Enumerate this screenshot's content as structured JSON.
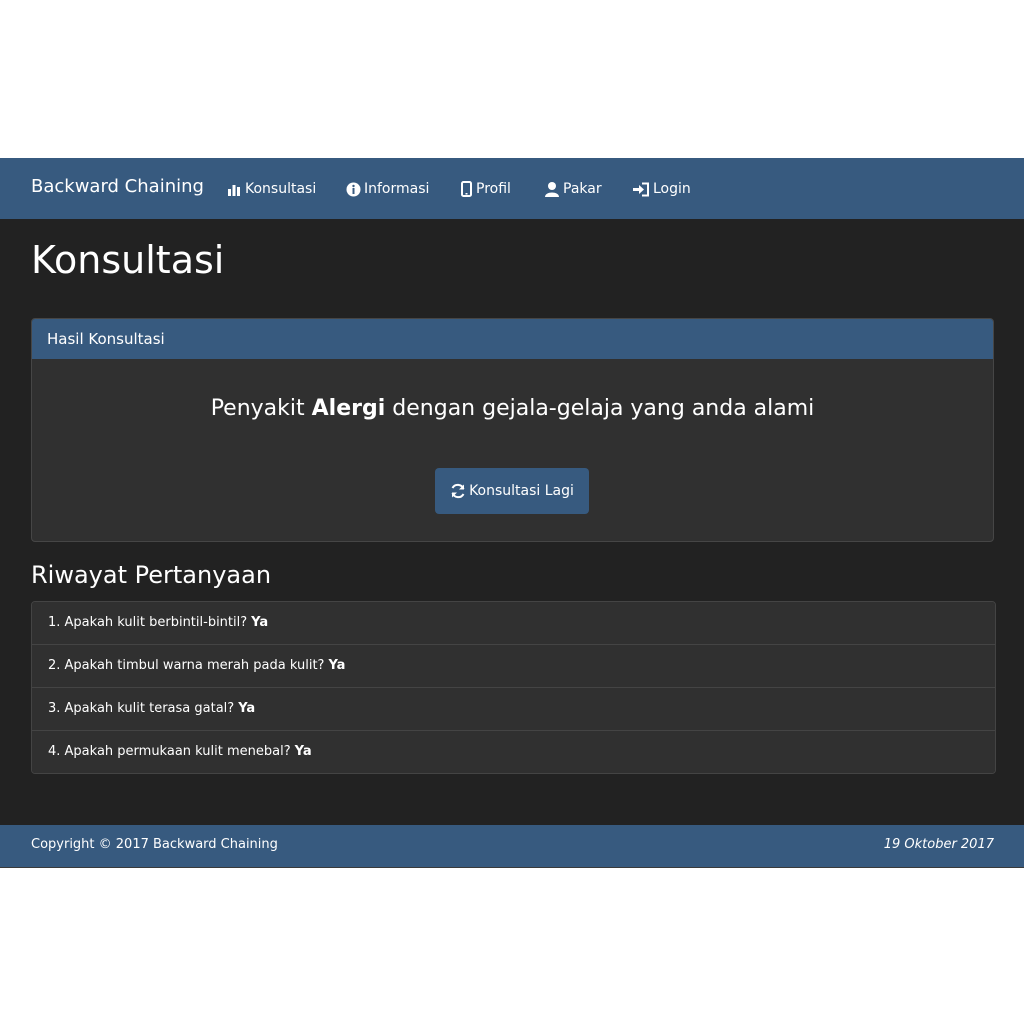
{
  "navbar": {
    "brand": "Backward Chaining",
    "items": [
      {
        "label": "Konsultasi",
        "icon": "bar-chart-icon"
      },
      {
        "label": "Informasi",
        "icon": "info-circle-icon"
      },
      {
        "label": "Profil",
        "icon": "mobile-phone-icon"
      },
      {
        "label": "Pakar",
        "icon": "user-icon"
      },
      {
        "label": "Login",
        "icon": "login-icon"
      }
    ]
  },
  "page": {
    "title": "Konsultasi"
  },
  "result_panel": {
    "heading": "Hasil Konsultasi",
    "result_prefix": "Penyakit",
    "disease": "Alergi",
    "result_suffix": "dengan gejala-gelaja yang anda alami",
    "button_label": "Konsultasi Lagi",
    "button_icon": "refresh-icon"
  },
  "history": {
    "title": "Riwayat Pertanyaan",
    "items": [
      {
        "question": "1. Apakah kulit berbintil-bintil?",
        "answer": "Ya"
      },
      {
        "question": "2. Apakah timbul warna merah pada kulit?",
        "answer": "Ya"
      },
      {
        "question": "3. Apakah kulit terasa gatal?",
        "answer": "Ya"
      },
      {
        "question": "4. Apakah permukaan kulit menebal?",
        "answer": "Ya"
      }
    ]
  },
  "footer": {
    "copyright": "Copyright © 2017 Backward Chaining",
    "date": "19 Oktober 2017"
  },
  "colors": {
    "primary": "#375a7f",
    "background": "#222222",
    "panel": "#303030"
  }
}
